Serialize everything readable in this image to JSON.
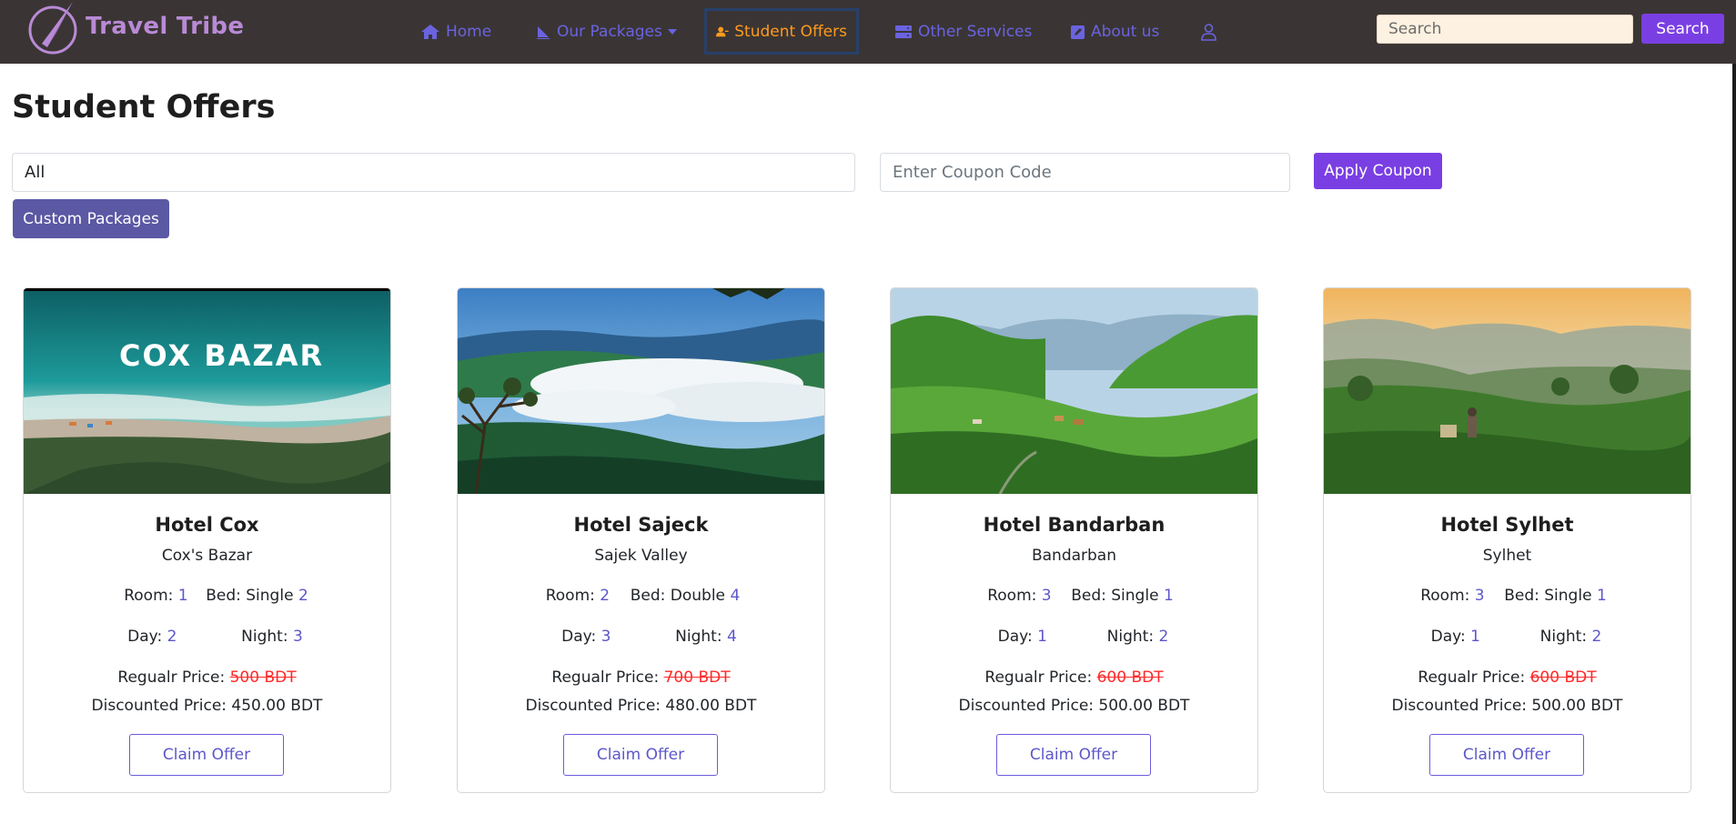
{
  "brand": {
    "name": "Travel Tribe",
    "color": "#b98ad6"
  },
  "nav": {
    "home": "Home",
    "packages": "Our Packages",
    "student_offers": "Student Offers",
    "other_services": "Other Services",
    "about": "About us",
    "search_placeholder": "Search",
    "search_button": "Search"
  },
  "page": {
    "title": "Student Offers",
    "filter_value": "All",
    "coupon_placeholder": "Enter Coupon Code",
    "apply_button": "Apply Coupon",
    "custom_button": "Custom Packages"
  },
  "labels": {
    "room": "Room:",
    "bed": "Bed:",
    "day": "Day:",
    "night": "Night:",
    "regular": "Regualr Price:",
    "discounted": "Discounted Price:",
    "claim": "Claim Offer"
  },
  "cards": [
    {
      "title": "Hotel Cox",
      "location": "Cox's Bazar",
      "room": "1",
      "bed_type": "Single",
      "bed": "2",
      "day": "2",
      "night": "3",
      "regular_price": "500 BDT",
      "discounted_price": "450.00 BDT",
      "image_text": "COX BAZAR"
    },
    {
      "title": "Hotel Sajeck",
      "location": "Sajek Valley",
      "room": "2",
      "bed_type": "Double",
      "bed": "4",
      "day": "3",
      "night": "4",
      "regular_price": "700 BDT",
      "discounted_price": "480.00 BDT"
    },
    {
      "title": "Hotel Bandarban",
      "location": "Bandarban",
      "room": "3",
      "bed_type": "Single",
      "bed": "1",
      "day": "1",
      "night": "2",
      "regular_price": "600 BDT",
      "discounted_price": "500.00 BDT"
    },
    {
      "title": "Hotel Sylhet",
      "location": "Sylhet",
      "room": "3",
      "bed_type": "Single",
      "bed": "1",
      "day": "1",
      "night": "2",
      "regular_price": "600 BDT",
      "discounted_price": "500.00 BDT"
    }
  ],
  "colors": {
    "navbar_bg": "#3a3534",
    "nav_link": "#6a63e0",
    "nav_active": "#ff9a1f",
    "primary_button": "#7a3fe3",
    "secondary_button": "#5b58a4",
    "strike_price": "#ff2a2a"
  }
}
